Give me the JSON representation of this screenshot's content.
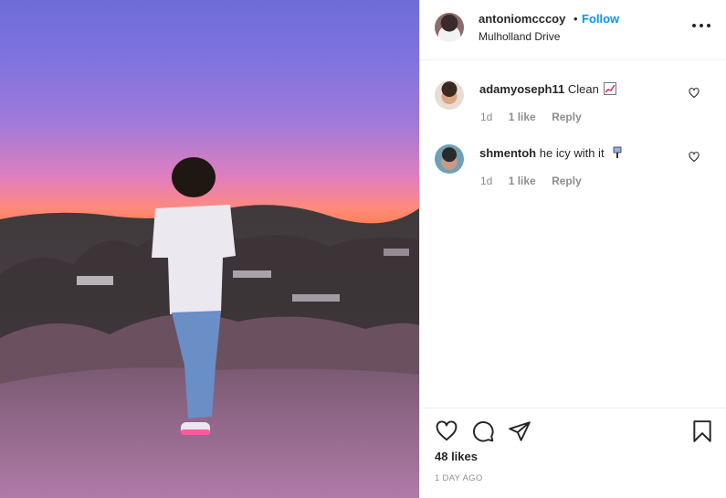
{
  "post": {
    "author": {
      "username": "antoniomcccoy",
      "separator": "•",
      "follow_label": "Follow",
      "location": "Mulholland Drive"
    },
    "comments": [
      {
        "username": "adamyoseph11",
        "text": "Clean",
        "emoji": "chart-increasing-emoji",
        "time": "1d",
        "likes": "1 like",
        "reply_label": "Reply"
      },
      {
        "username": "shmentoh",
        "text": "he icy with it",
        "emoji": "ice-emoji",
        "time": "1d",
        "likes": "1 like",
        "reply_label": "Reply"
      }
    ],
    "likes_count": "48 likes",
    "posted_date": "1 DAY AGO",
    "icons": {
      "more": "more-options-icon",
      "like": "heart-icon",
      "comment": "comment-icon",
      "share": "paper-plane-icon",
      "save": "bookmark-icon"
    },
    "colors": {
      "follow": "#0095f6",
      "text": "#262626",
      "muted": "#8e8e8e"
    }
  }
}
